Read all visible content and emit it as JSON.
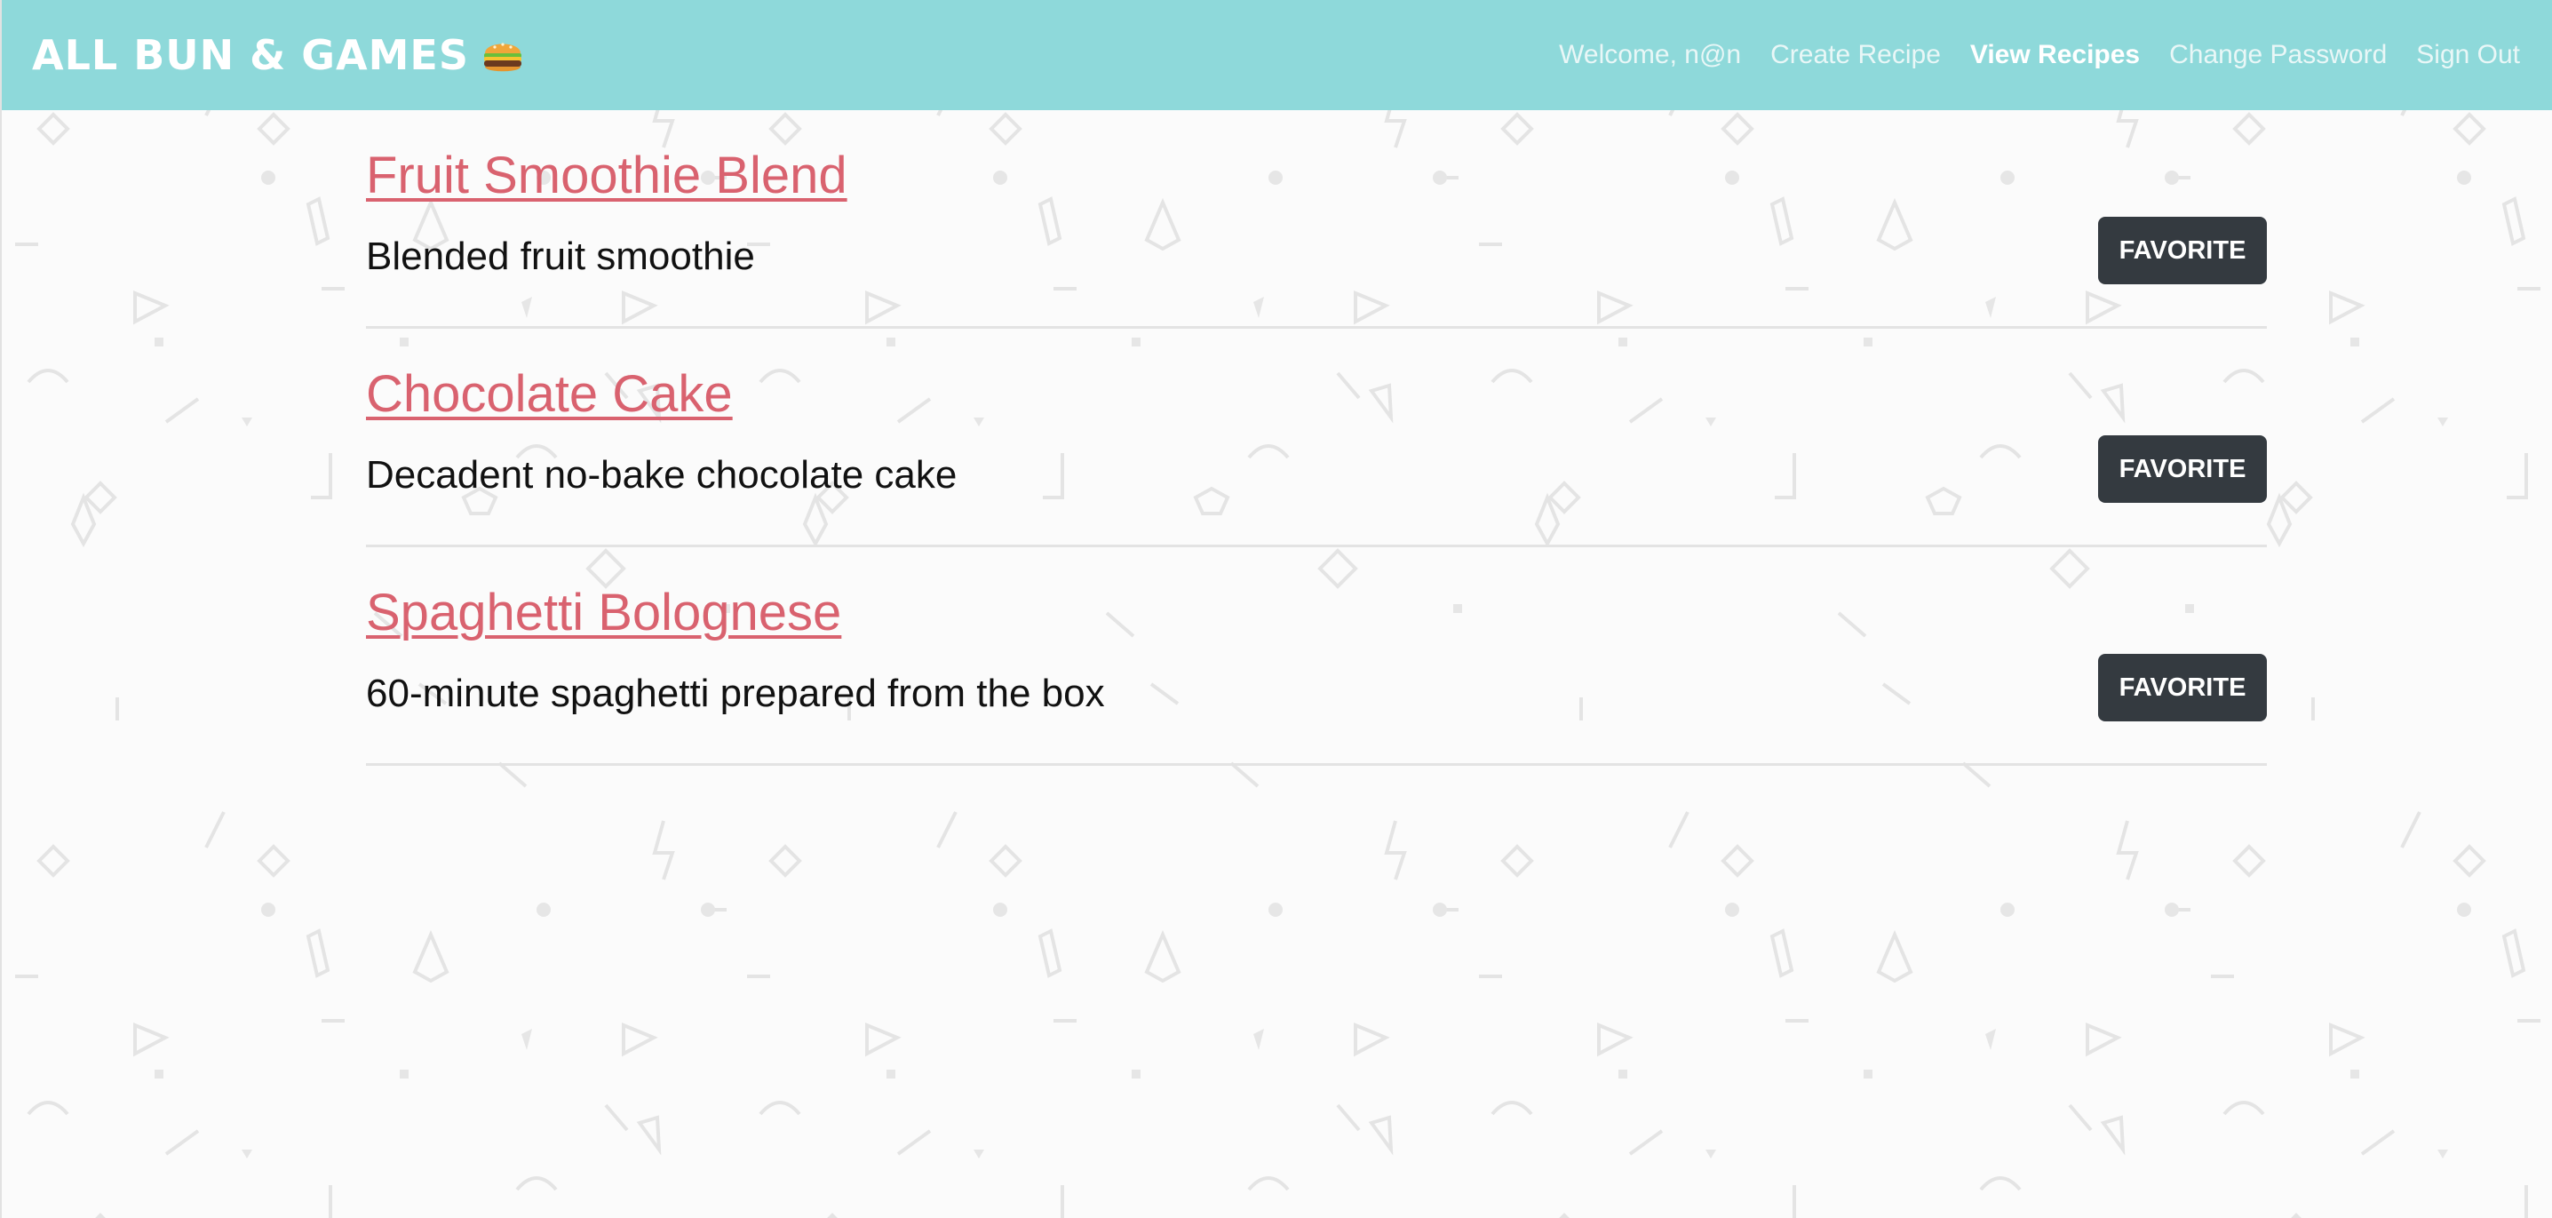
{
  "header": {
    "brand": "ALL BUN & GAMES",
    "brand_icon": "hamburger-icon",
    "background_color": "#8ed9da"
  },
  "nav": {
    "welcome": "Welcome, n@n",
    "links": [
      {
        "label": "Create Recipe",
        "active": false
      },
      {
        "label": "View Recipes",
        "active": true
      },
      {
        "label": "Change Password",
        "active": false
      },
      {
        "label": "Sign Out",
        "active": false
      }
    ]
  },
  "recipes": [
    {
      "title": "Fruit Smoothie Blend",
      "description": "Blended fruit smoothie",
      "button": "FAVORITE"
    },
    {
      "title": "Chocolate Cake",
      "description": "Decadent no-bake chocolate cake",
      "button": "FAVORITE"
    },
    {
      "title": "Spaghetti Bolognese",
      "description": "60-minute spaghetti prepared from the box",
      "button": "FAVORITE"
    }
  ],
  "colors": {
    "link": "#d9626f",
    "button": "#343a40"
  }
}
